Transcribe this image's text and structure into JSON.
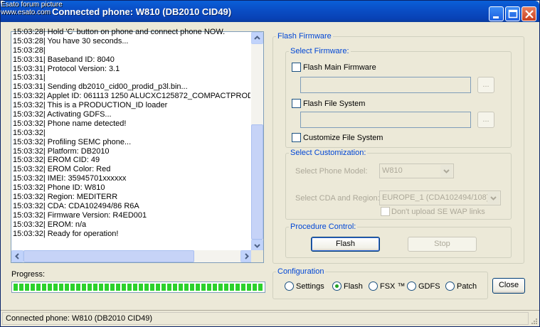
{
  "window": {
    "title": "Connected phone: W810 (DB2010 CID49)",
    "watermark_line1": "Esato forum picture",
    "watermark_line2": "www.esato.com"
  },
  "log": {
    "lines": [
      "15:03:28| Hold 'C' button on phone and connect phone NOW.",
      "15:03:28| You have 30 seconds...",
      "15:03:28|",
      "15:03:31| Baseband ID: 8040",
      "15:03:31| Protocol Version: 3.1",
      "15:03:31|",
      "15:03:31| Sending db2010_cid00_prodid_p3l.bin...",
      "15:03:32| Applet ID: 061113 1250 ALUCXC125872_COMPACTPRODU",
      "15:03:32| This is a PRODUCTION_ID loader",
      "15:03:32| Activating GDFS...",
      "15:03:32| Phone name detected!",
      "15:03:32|",
      "15:03:32| Profiling SEMC phone...",
      "15:03:32| Platform: DB2010",
      "15:03:32| EROM CID: 49",
      "15:03:32| EROM Color: Red",
      "15:03:32| IMEI: 35945701xxxxxx",
      "15:03:32| Phone ID: W810",
      "15:03:32| Region: MEDITERR",
      "15:03:32| CDA: CDA102494/86   R6A",
      "15:03:32| Firmware Version: R4ED001",
      "15:03:32| EROM: n/a",
      "15:03:32| Ready for operation!"
    ]
  },
  "progress": {
    "label": "Progress:",
    "fraction": 1.0
  },
  "flash_firmware": {
    "legend": "Flash Firmware",
    "select_firmware": {
      "legend": "Select Firmware:",
      "main_firmware_label": "Flash Main Firmware",
      "file_system_label": "Flash File System",
      "customize_label": "Customize File System",
      "browse_label": "..."
    },
    "select_customization": {
      "legend": "Select Customization:",
      "phone_model_label": "Select Phone Model:",
      "phone_model_value": "W810",
      "cda_label": "Select CDA and Region:",
      "cda_value": "EUROPE_1 (CDA102494/108)",
      "wap_label": "Don't upload SE WAP links"
    },
    "procedure_control": {
      "legend": "Procedure Control:",
      "flash_button": "Flash",
      "stop_button": "Stop"
    }
  },
  "configuration": {
    "legend": "Configuration",
    "options": [
      "Settings",
      "Flash",
      "FSX ™",
      "GDFS",
      "Patch"
    ],
    "selected": "Flash"
  },
  "close_button": "Close",
  "status": {
    "text": "Connected phone: W810 (DB2010 CID49)"
  }
}
